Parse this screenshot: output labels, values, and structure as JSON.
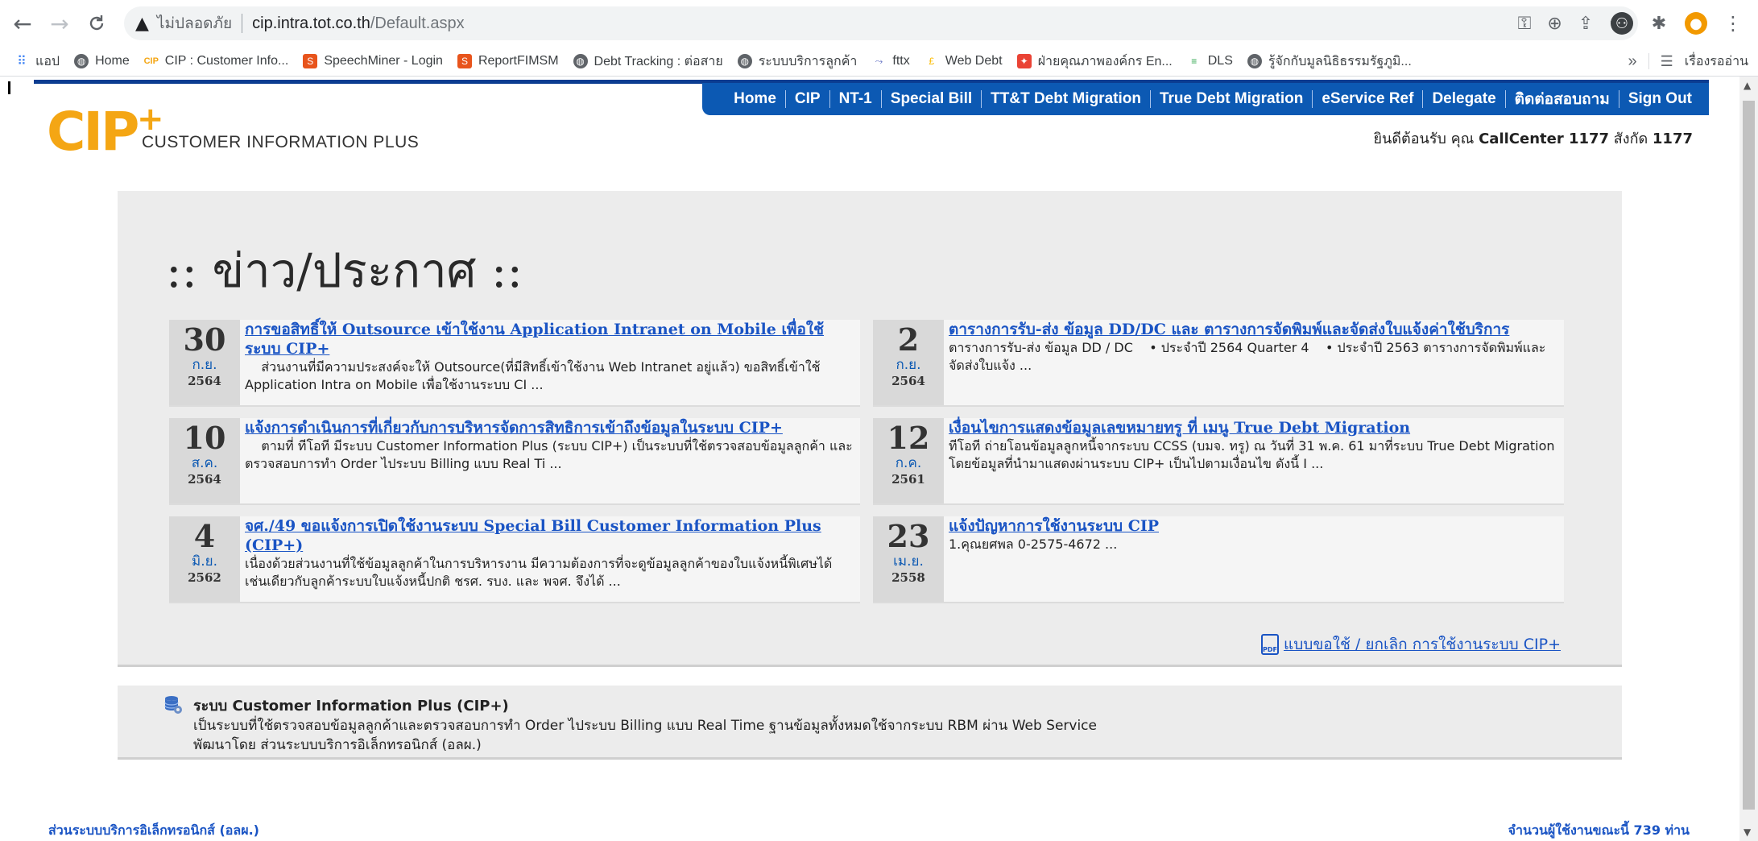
{
  "browser": {
    "back_icon": "←",
    "forward_icon": "→",
    "reload_icon": "C",
    "warning_icon": "▲",
    "insecure_label": "ไม่ปลอดภัย",
    "url_host": "cip.intra.tot.co.th",
    "url_path": "/Default.aspx",
    "bookmarks": [
      {
        "label": "แอป",
        "icon": "apps-grid-icon",
        "color": "#4285f4"
      },
      {
        "label": "Home",
        "icon": "globe-icon",
        "color": "#5f6368"
      },
      {
        "label": "CIP : Customer Info...",
        "icon": "cip-favicon",
        "color": "#f4a614"
      },
      {
        "label": "SpeechMiner - Login",
        "icon": "speechminer-favicon",
        "color": "#e8541c"
      },
      {
        "label": "ReportFIMSM",
        "icon": "report-favicon",
        "color": "#e8541c"
      },
      {
        "label": "Debt Tracking : ต่อสาย",
        "icon": "globe-icon",
        "color": "#5f6368"
      },
      {
        "label": "ระบบบริการลูกค้า",
        "icon": "globe-icon",
        "color": "#5f6368"
      },
      {
        "label": "fttx",
        "icon": "fttx-favicon",
        "color": "#5c6bc0"
      },
      {
        "label": "Web Debt",
        "icon": "webdebt-favicon",
        "color": "#fbbc04"
      },
      {
        "label": "ฝ่ายคุณภาพองค์กร En...",
        "icon": "quality-favicon",
        "color": "#ea4335"
      },
      {
        "label": "DLS",
        "icon": "dls-favicon",
        "color": "#34a853"
      },
      {
        "label": "รู้จักกับมูลนิธิธรรมรัฐภูมิ...",
        "icon": "globe-icon",
        "color": "#5f6368"
      }
    ],
    "more_bookmarks": "»",
    "reading_list": "เรื่องรออ่าน"
  },
  "nav": {
    "items": [
      "Home",
      "CIP",
      "NT-1",
      "Special Bill",
      "TT&T Debt Migration",
      "True Debt Migration",
      "eService Ref",
      "Delegate",
      "ติดต่อสอบถาม",
      "Sign Out"
    ]
  },
  "header": {
    "logo_text": "CIP",
    "logo_plus": "+",
    "logo_sub": "CUSTOMER INFORMATION PLUS",
    "welcome_prefix": "ยินดีต้อนรับ คุณ ",
    "welcome_user": "CallCenter 1177",
    "welcome_mid": " สังกัด ",
    "welcome_dept": "1177"
  },
  "news": {
    "heading": ":: ข่าว/ประกาศ ::",
    "items": [
      {
        "day": "30",
        "month": "ก.ย.",
        "year": "2564",
        "title": "การขอสิทธิ์ให้ Outsource เข้าใช้งาน Application Intranet on Mobile เพื่อใช้ระบบ CIP+",
        "text": "    ส่วนงานที่มีความประสงค์จะให้ Outsource(ที่มีสิทธิ์เข้าใช้งาน Web Intranet อยู่แล้ว) ขอสิทธิ์เข้าใช้ Application Intra on Mobile เพื่อใช้งานระบบ CI ..."
      },
      {
        "day": "2",
        "month": "ก.ย.",
        "year": "2564",
        "title": "ตารางการรับ-ส่ง ข้อมูล DD/DC และ ตารางการจัดพิมพ์และจัดส่งใบแจ้งค่าใช้บริการ",
        "text": "ตารางการรับ-ส่ง ข้อมูล DD / DC    • ประจำปี 2564 Quarter 4    • ประจำปี 2563 ตารางการจัดพิมพ์และจัดส่งใบแจ้ง ..."
      },
      {
        "day": "10",
        "month": "ส.ค.",
        "year": "2564",
        "title": "แจ้งการดำเนินการที่เกี่ยวกับการบริหารจัดการสิทธิการเข้าถึงข้อมูลในระบบ CIP+",
        "text": "    ตามที่ ทีโอที มีระบบ Customer Information Plus (ระบบ CIP+) เป็นระบบที่ใช้ตรวจสอบข้อมูลลูกค้า และตรวจสอบการทำ Order ไประบบ Billing แบบ Real Ti ..."
      },
      {
        "day": "12",
        "month": "ก.ค.",
        "year": "2561",
        "title": "เงื่อนไขการแสดงข้อมูลเลขหมายทรู ที่ เมนู True Debt Migration",
        "text": "ทีโอที ถ่ายโอนข้อมูลลูกหนี้จากระบบ CCSS (บมจ. ทรู) ณ วันที่ 31 พ.ค. 61 มาที่ระบบ True Debt Migration โดยข้อมูลที่นำมาแสดงผ่านระบบ CIP+ เป็นไปตามเงื่อนไข ดังนี้ I ..."
      },
      {
        "day": "4",
        "month": "มิ.ย.",
        "year": "2562",
        "title": "จศ./49 ขอแจ้งการเปิดใช้งานระบบ Special Bill Customer Information Plus (CIP+)",
        "text": "เนื่องด้วยส่วนงานที่ใช้ข้อมูลลูกค้าในการบริหารงาน มีความต้องการที่จะดูข้อมูลลูกค้าของใบแจ้งหนี้พิเศษได้เช่นเดียวกับลูกค้าระบบใบแจ้งหนี้ปกติ ชรศ. รบง. และ พจศ. จึงได้ ..."
      },
      {
        "day": "23",
        "month": "เม.ย.",
        "year": "2558",
        "title": "แจ้งปัญหาการใช้งานระบบ CIP",
        "text": "1.คุณยศพล 0-2575-4672 ..."
      }
    ],
    "form_link": "แบบขอใช้ / ยกเลิก การใช้งานระบบ CIP+",
    "pdf_label": "PDF"
  },
  "info": {
    "title": "ระบบ Customer Information Plus (CIP+)",
    "line1": "เป็นระบบที่ใช้ตรวจสอบข้อมูลลูกค้าและตรวจสอบการทำ Order ไประบบ Billing แบบ Real Time ฐานข้อมูลทั้งหมดใช้จากระบบ RBM ผ่าน Web Service",
    "line2": "พัฒนาโดย ส่วนระบบบริการอิเล็กทรอนิกส์ (อลผ.)"
  },
  "footer": {
    "left": "ส่วนระบบบริการอิเล็กทรอนิกส์ (อลผ.)",
    "right": "จำนวนผู้ใช้งานขณะนี้ 739 ท่าน"
  },
  "colors": {
    "nav_blue": "#0c59b3",
    "link_blue": "#1a54c4",
    "logo_orange": "#f4a614"
  }
}
